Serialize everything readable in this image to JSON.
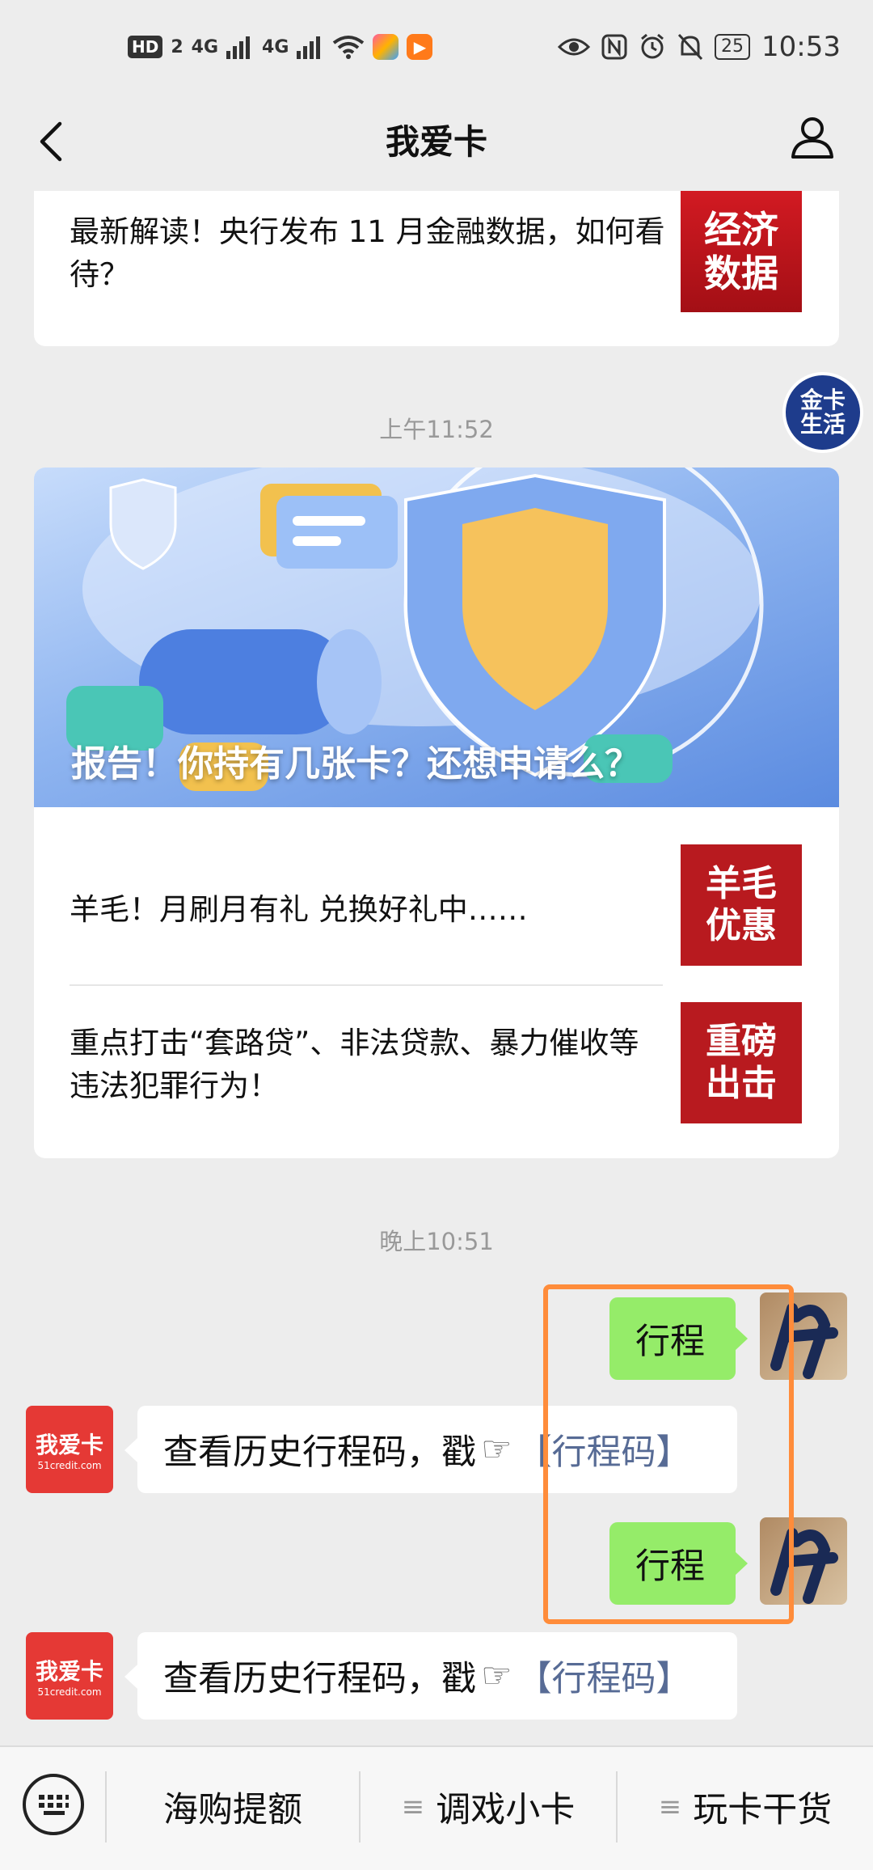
{
  "status_bar": {
    "hd": "HD",
    "sim": "2",
    "net1": "4G",
    "net2": "4G",
    "battery": "25",
    "time": "10:53",
    "icons": [
      "eye-icon",
      "nfc-icon",
      "alarm-icon",
      "mute-icon"
    ]
  },
  "nav": {
    "title": "我爱卡",
    "back_icon": "back-arrow-icon",
    "profile_icon": "person-icon"
  },
  "messages": {
    "card1": {
      "text": "最新解读！央行发布 11 月金融数据，如何看待？",
      "thumb": [
        "经济",
        "数据"
      ]
    },
    "floating_badge": [
      "金卡",
      "生活"
    ],
    "time1": "上午11:52",
    "card2": {
      "banner_title": "报告！你持有几张卡？还想申请么？",
      "items": [
        {
          "text": "羊毛！月刷月有礼 兑换好礼中……",
          "thumb": [
            "羊毛",
            "优惠"
          ]
        },
        {
          "text": "重点打击“套路贷”、非法贷款、暴力催收等违法犯罪行为！",
          "thumb": [
            "重磅",
            "出击"
          ]
        }
      ]
    },
    "time2": "晚上10:51",
    "chat": [
      {
        "from": "user",
        "text": "行程"
      },
      {
        "from": "bot",
        "text": "查看历史行程码，戳",
        "pointer": "☞",
        "link": "【行程码】",
        "avatar_text": "我爱卡",
        "avatar_sub": "51credit.com"
      },
      {
        "from": "user",
        "text": "行程"
      },
      {
        "from": "bot",
        "text": "查看历史行程码，戳",
        "pointer": "☞",
        "link": "【行程码】",
        "avatar_text": "我爱卡",
        "avatar_sub": "51credit.com"
      }
    ]
  },
  "bottom_menu": {
    "keyboard_icon": "keyboard-icon",
    "items": [
      "海购提额",
      "调戏小卡",
      "玩卡干货"
    ],
    "menu_glyph": "≡"
  },
  "colors": {
    "highlight": "#ff8c3a",
    "bubble_green": "#95ec69",
    "link": "#576b95",
    "thumb_red": "#c8161d"
  }
}
